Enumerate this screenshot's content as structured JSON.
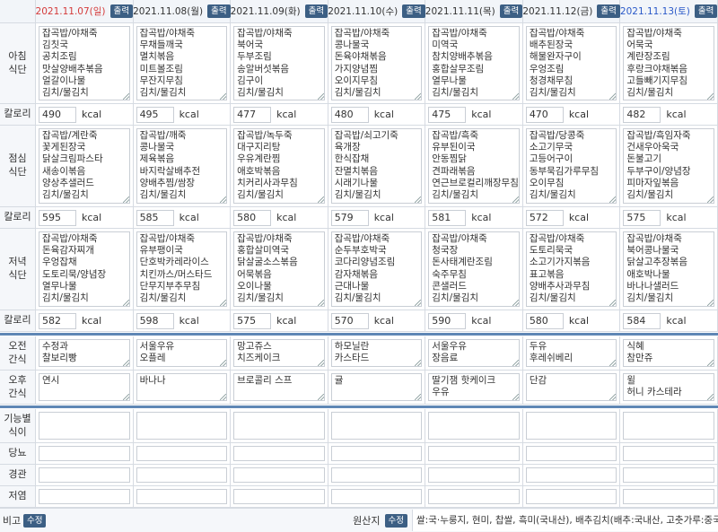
{
  "days": [
    {
      "date": "2021.11.07(일)",
      "type": "sun"
    },
    {
      "date": "2021.11.08(월)",
      "type": "wk"
    },
    {
      "date": "2021.11.09(화)",
      "type": "wk"
    },
    {
      "date": "2021.11.10(수)",
      "type": "wk"
    },
    {
      "date": "2021.11.11(목)",
      "type": "wk"
    },
    {
      "date": "2021.11.12(금)",
      "type": "wk"
    },
    {
      "date": "2021.11.13(토)",
      "type": "sat"
    }
  ],
  "print_label": "출력",
  "labels": {
    "breakfast": "아침\n식단",
    "lunch": "점심\n식단",
    "dinner": "저녁\n식단",
    "calorie": "칼로리",
    "am_snack": "오전\n간식",
    "pm_snack": "오후\n간식",
    "special": "기능별\n식이",
    "sugar": "당뇨",
    "tube": "경관",
    "lowsalt": "저염",
    "note": "비고",
    "origin": "원산지",
    "edit": "수정",
    "kcal": "kcal"
  },
  "breakfast": [
    "잡곡밥/야채죽\n김칫국\n공치조림\n맛살양배추볶음\n얼갈이나물\n김치/물김치",
    "잡곡밥/야채죽\n무채들깨국\n멸치볶음\n미트볼조림\n무잔지무침\n김치/물김치",
    "잡곡밥/야채죽\n북어국\n두부조림\n송알버섯볶음\n김구이\n김치/물김치",
    "잡곡밥/야채죽\n콩나물국\n돈육야채볶음\n가지양념찜\n오이지무침\n김치/물김치",
    "잡곡밥/야채죽\n미역국\n참치양배추볶음\n홍합살무조림\n열무나물\n김치/물김치",
    "잡곡밥/야채죽\n배추된장국\n해물완자구이\n우엉조림\n청경채무침\n김치/물김치",
    "잡곡밥/야채죽\n어묵국\n계란장조림\n후랑크야채볶음\n고들빼기지무침\n김치/물김치"
  ],
  "breakfast_kcal": [
    "490",
    "495",
    "477",
    "480",
    "475",
    "470",
    "482"
  ],
  "lunch": [
    "잡곡밥/계란죽\n꽃게된장국\n닭살크림파스타\n새송이볶음\n양상추샐러드\n김치/물김치",
    "잡곡밥/깨죽\n콩나물국\n제육볶음\n바지락살배추전\n양배추찜/쌈장\n김치/물김치",
    "잡곡밥/녹두죽\n대구지리탕\n우유계란찜\n애호박볶음\n치커리사과무침\n김치/물김치",
    "잡곡밥/쇠고기죽\n육개장\n한식잡채\n잔멸치볶음\n시래기나물\n김치/물김치",
    "잡곡밥/흑죽\n유부된이국\n안동찜닭\n견파래볶음\n연근브로컬리깨장무침\n김치/물김치",
    "잡곡밥/당콩죽\n소고기무국\n고등어구이\n동부묵김가루무침\n오이무침\n김치/물김치",
    "잡곡밥/흑임자죽\n건새우아욱국\n돈불고기\n두부구이/양념장\n피마자잎볶음\n김치/물김치"
  ],
  "lunch_kcal": [
    "595",
    "585",
    "580",
    "579",
    "581",
    "572",
    "575"
  ],
  "dinner": [
    "잡곡밥/야채죽\n돈육감자찌개\n우엉잡채\n도토리묵/양념장\n열무나물\n김치/물김치",
    "잡곡밥/야채죽\n유부팽이국\n단호박카레라이스\n치킨까스/머스타드\n단무지부추무침\n김치/물김치",
    "잡곡밥/야채죽\n홍합살미역국\n닭살굴소스볶음\n어묵볶음\n오이나물\n김치/물김치",
    "잡곡밥/야채죽\n순두부호박국\n코다리양념조림\n감자채볶음\n근대나물\n김치/물김치",
    "잡곡밥/야채죽\n청국장\n돈사태계란조림\n숙주무침\n콘샐러드\n김치/물김치",
    "잡곡밥/야채죽\n도토리묵국\n소고기가지볶음\n표고볶음\n양배추사과무침\n김치/물김치",
    "잡곡밥/야채죽\n북어콩나물국\n닭살고추장볶음\n애호박나물\n바나나샐러드\n김치/물김치"
  ],
  "dinner_kcal": [
    "582",
    "598",
    "575",
    "570",
    "590",
    "580",
    "584"
  ],
  "am_snack": [
    "수정과\n찰보리빵",
    "서울우유\n오플레",
    "망고쥬스\n치즈케이크",
    "하모닐란\n카스타드",
    "서울우유\n장음료",
    "두유\n후레쉬베리",
    "식혜\n참만쥬"
  ],
  "pm_snack": [
    "연시",
    "바나나",
    "브로콜리 스프",
    "귤",
    "딸기잼 핫케이크\n우유",
    "단감",
    "윌\n허니 카스테라"
  ],
  "origin_text": "쌀:국·누룽지, 현미, 찹쌀, 흑미(국내산), 배추김치(배추:국내산, 고춧가루:중국산)"
}
